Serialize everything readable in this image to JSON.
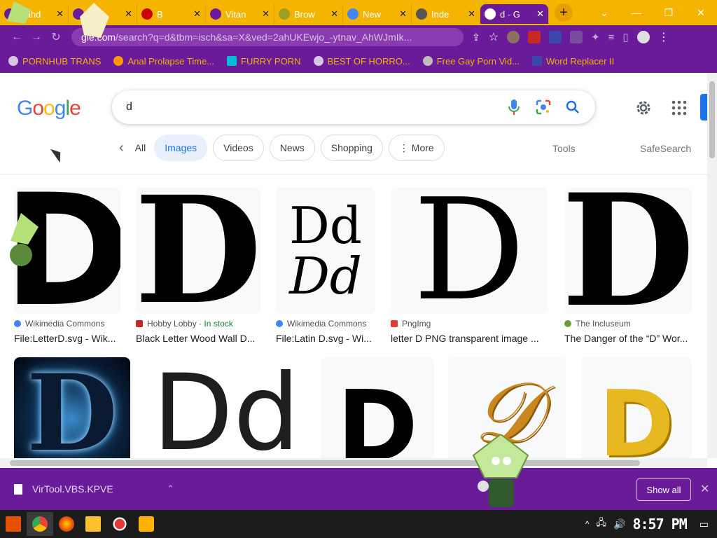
{
  "browser": {
    "tabs": [
      {
        "title": "Bahd",
        "close": "✕"
      },
      {
        "title": "M",
        "close": "✕"
      },
      {
        "title": "B",
        "close": "✕"
      },
      {
        "title": "Vitan",
        "close": "✕"
      },
      {
        "title": "Brow",
        "close": "✕"
      },
      {
        "title": "New",
        "close": "✕"
      },
      {
        "title": "Inde",
        "close": "✕"
      },
      {
        "title": "d - G",
        "close": "✕"
      }
    ],
    "new_tab": "+",
    "window_controls": {
      "chevron": "⌄",
      "minimize": "—",
      "restore": "❐",
      "close": "✕"
    },
    "url_host": "gle.com",
    "url_path": "/search?q=d&tbm=isch&sa=X&ved=2ahUKEwjo_-ytnav_AhWJmIk...",
    "bookmarks": [
      "PORNHUB TRANS",
      "Anal Prolapse Time...",
      "FURRY PORN",
      "BEST OF HORRO...",
      "Free Gay Porn Vid...",
      "Word Replacer II"
    ]
  },
  "google": {
    "logo": {
      "G": "G",
      "o1": "o",
      "o2": "o",
      "g": "g",
      "l": "l",
      "e": "e"
    },
    "query": "d",
    "chips": {
      "back": "‹",
      "all": "All",
      "images": "Images",
      "videos": "Videos",
      "news": "News",
      "shopping": "Shopping",
      "more": "⋮ More"
    },
    "tools": "Tools",
    "safesearch": "SafeSearch",
    "results": [
      {
        "source": "Wikimedia Commons",
        "title": "File:LetterD.svg - Wik...",
        "letter": "D"
      },
      {
        "source": "Hobby Lobby",
        "stock": "In stock",
        "title": "Black Letter Wood Wall D...",
        "letter": "D"
      },
      {
        "source": "Wikimedia Commons",
        "title": "File:Latin D.svg - Wi...",
        "letter_top": "Dd",
        "letter_bottom": "Dd"
      },
      {
        "source": "PngImg",
        "title": "letter D PNG transparent image ...",
        "letter": "D"
      },
      {
        "source": "The Incluseum",
        "title": "The Danger of the “D” Wor...",
        "letter": "D"
      }
    ],
    "row2": {
      "glow": "D",
      "dd": "Dd",
      "d": "D",
      "script": "𝒟",
      "gold": "D"
    }
  },
  "downloads": {
    "file": "VirTool.VBS.KPVE",
    "chevron": "⌃",
    "show_all": "Show all",
    "close": "✕"
  },
  "taskbar": {
    "clock": "8:57 PM"
  },
  "colors": {
    "tab_bar": "#f4b400",
    "chrome_purple": "#6a1b9a",
    "bookmark_text": "#f4b400"
  }
}
